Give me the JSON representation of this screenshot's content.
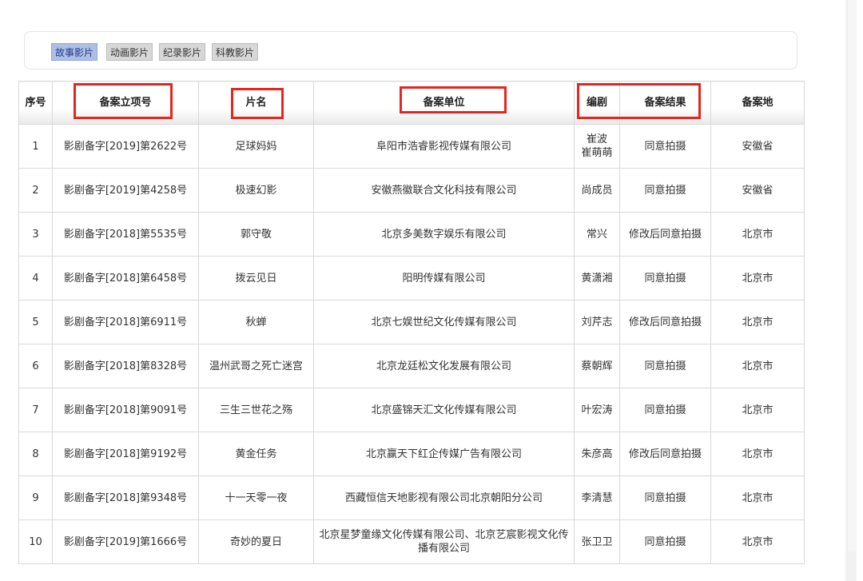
{
  "tabs": [
    {
      "label": "故事影片",
      "active": true
    },
    {
      "label": "动画影片",
      "active": false
    },
    {
      "label": "纪录影片",
      "active": false
    },
    {
      "label": "科教影片",
      "active": false
    }
  ],
  "table": {
    "headers": [
      "序号",
      "备案立项号",
      "片名",
      "备案单位",
      "编剧",
      "备案结果",
      "备案地"
    ],
    "rows": [
      [
        "1",
        "影剧备字[2019]第2622号",
        "足球妈妈",
        "阜阳市浩睿影视传媒有限公司",
        "崔波\n崔萌萌",
        "同意拍摄",
        "安徽省"
      ],
      [
        "2",
        "影剧备字[2019]第4258号",
        "极速幻影",
        "安徽燕徽联合文化科技有限公司",
        "尚成员",
        "同意拍摄",
        "安徽省"
      ],
      [
        "3",
        "影剧备字[2018]第5535号",
        "郭守敬",
        "北京多美数字娱乐有限公司",
        "常兴",
        "修改后同意拍摄",
        "北京市"
      ],
      [
        "4",
        "影剧备字[2018]第6458号",
        "拨云见日",
        "阳明传媒有限公司",
        "黄潇湘",
        "同意拍摄",
        "北京市"
      ],
      [
        "5",
        "影剧备字[2018]第6911号",
        "秋蝉",
        "北京七娱世纪文化传媒有限公司",
        "刘芹志",
        "修改后同意拍摄",
        "北京市"
      ],
      [
        "6",
        "影剧备字[2018]第8328号",
        "温州武哥之死亡迷宫",
        "北京龙廷松文化发展有限公司",
        "蔡朝辉",
        "同意拍摄",
        "北京市"
      ],
      [
        "7",
        "影剧备字[2018]第9091号",
        "三生三世花之殇",
        "北京盛锦天汇文化传媒有限公司",
        "叶宏涛",
        "同意拍摄",
        "北京市"
      ],
      [
        "8",
        "影剧备字[2018]第9192号",
        "黄金任务",
        "北京赢天下红企传媒广告有限公司",
        "朱彦高",
        "修改后同意拍摄",
        "北京市"
      ],
      [
        "9",
        "影剧备字[2018]第9348号",
        "十一天零一夜",
        "西藏恒信天地影视有限公司北京朝阳分公司",
        "李清慧",
        "同意拍摄",
        "北京市"
      ],
      [
        "10",
        "影剧备字[2019]第1666号",
        "奇妙的夏日",
        "北京星梦童缘文化传媒有限公司、北京艺宸影视文化传播有限公司",
        "张卫卫",
        "同意拍摄",
        "北京市"
      ]
    ]
  },
  "colors": {
    "highlight": "#e5261f",
    "active_tab": "#aebfe3",
    "tab": "#d7d7d7"
  }
}
